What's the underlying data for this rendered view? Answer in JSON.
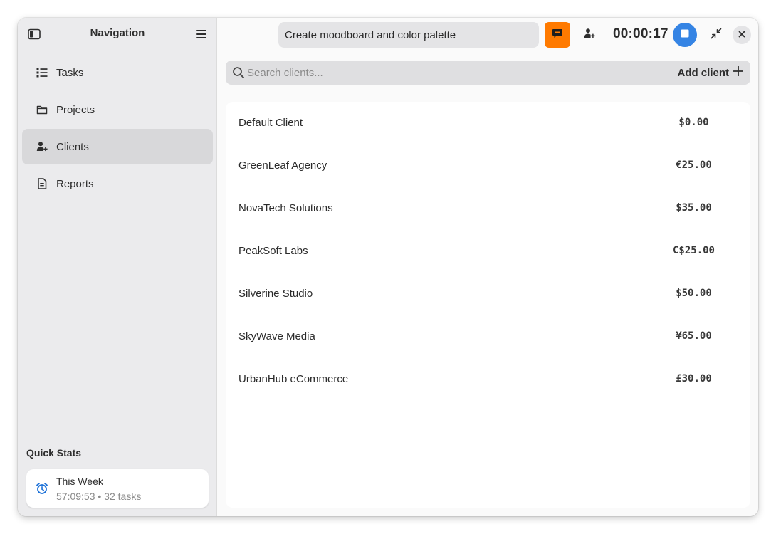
{
  "sidebar": {
    "title": "Navigation",
    "items": [
      {
        "label": "Tasks",
        "icon": "task-list-icon"
      },
      {
        "label": "Projects",
        "icon": "folder-icon"
      },
      {
        "label": "Clients",
        "icon": "person-add-icon",
        "active": true
      },
      {
        "label": "Reports",
        "icon": "document-icon"
      }
    ],
    "quick_stats": {
      "title": "Quick Stats",
      "card_label": "This Week",
      "card_sub": "57:09:53 • 32 tasks"
    }
  },
  "topbar": {
    "task_value": "Create moodboard and color palette",
    "timer": "00:00:17"
  },
  "search": {
    "placeholder": "Search clients...",
    "add_label": "Add client"
  },
  "clients": [
    {
      "name": "Default Client",
      "rate": "$0.00"
    },
    {
      "name": "GreenLeaf Agency",
      "rate": "€25.00"
    },
    {
      "name": "NovaTech Solutions",
      "rate": "$35.00"
    },
    {
      "name": "PeakSoft Labs",
      "rate": "C$25.00"
    },
    {
      "name": "Silverine Studio",
      "rate": "$50.00"
    },
    {
      "name": "SkyWave Media",
      "rate": "¥65.00"
    },
    {
      "name": "UrbanHub eCommerce",
      "rate": "£30.00"
    }
  ],
  "colors": {
    "accent_orange": "#ff7a00",
    "accent_blue": "#3584e4"
  }
}
